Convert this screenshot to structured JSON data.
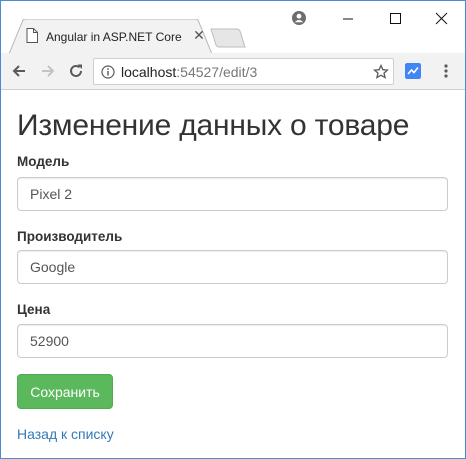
{
  "browser": {
    "tab_title": "Angular in ASP.NET Core",
    "url_host": "localhost",
    "url_path": ":54527/edit/3",
    "icons": {
      "tab": "document-icon",
      "tab_close": "close-icon",
      "profile": "profile-icon",
      "back": "back-arrow-icon",
      "forward": "forward-arrow-icon",
      "reload": "reload-icon",
      "info": "info-icon",
      "bookmark": "star-icon",
      "extension": "extension-icon",
      "menu": "kebab-menu-icon"
    },
    "tab_close_glyph": "✕"
  },
  "page": {
    "title": "Изменение данных о товаре",
    "fields": [
      {
        "label": "Модель",
        "value": "Pixel 2"
      },
      {
        "label": "Производитель",
        "value": "Google"
      },
      {
        "label": "Цена",
        "value": "52900"
      }
    ],
    "save_label": "Сохранить",
    "back_link": "Назад к списку"
  },
  "colors": {
    "save_button": "#5cb85c",
    "link": "#337ab7",
    "window_border": "#4a8bd6",
    "extension": "#4285f4"
  }
}
